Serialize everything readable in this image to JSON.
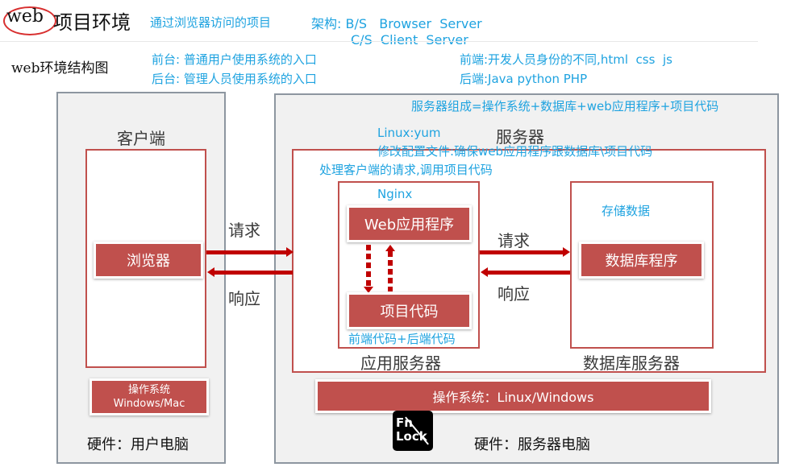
{
  "header": {
    "title_circled": "web",
    "title_rest": "项目环境",
    "subtitle": "通过浏览器访问的项目",
    "arch_label": "架构: B/S   Browser  Server",
    "arch_line2": "C/S  Client  Server"
  },
  "notes": {
    "structure_title": "web环境结构图",
    "frontend_desk": "前台: 普通用户使用系统的入口",
    "backend_desk": "后台: 管理人员使用系统的入口",
    "frontend_dev": "前端:开发人员身份的不同,html  css  js",
    "backend_dev": "后端:Java python PHP",
    "server_composition": "服务器组成=操作系统+数据库+web应用程序+项目代码",
    "linux_yum": "Linux:yum",
    "config_note": "修改配置文件:确保web应用程序跟数据库\\项目代码",
    "handle_request": "处理客户端的请求,调用项目代码",
    "nginx": "Nginx",
    "store_data": "存储数据",
    "code_note": "前端代码+后端代码"
  },
  "client": {
    "title": "客户端",
    "browser": "浏览器",
    "os_line1": "操作系统",
    "os_line2": "Windows/Mac",
    "hardware": "硬件：用户电脑"
  },
  "server": {
    "title": "服务器",
    "web_app": "Web应用程序",
    "project_code": "项目代码",
    "app_server": "应用服务器",
    "db_program": "数据库程序",
    "db_server": "数据库服务器",
    "os": "操作系统：Linux/Windows",
    "hardware": "硬件：服务器电脑"
  },
  "arrows": {
    "request_1": "请求",
    "response_1": "响应",
    "request_2": "请求",
    "response_2": "响应"
  },
  "overlay": {
    "fn_lock_line1": "Fn",
    "fn_lock_line2": "Lock"
  },
  "colors": {
    "accent_red": "#c0504d",
    "arrow_red": "#c00000",
    "note_blue": "#1fa3e0",
    "panel_gray": "#f1f1f1"
  }
}
